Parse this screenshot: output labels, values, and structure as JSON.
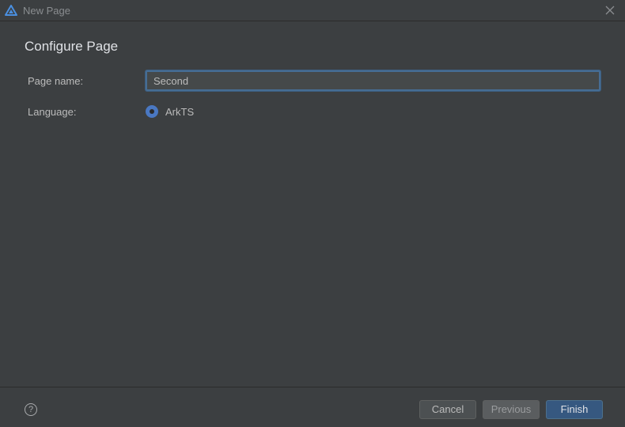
{
  "window": {
    "title": "New Page",
    "app_icon": "deveco-logo-icon",
    "close_icon": "close-icon"
  },
  "heading": "Configure Page",
  "form": {
    "page_name_label": "Page name:",
    "page_name_value": "Second",
    "language_label": "Language:",
    "language_option": "ArkTS",
    "language_selected": true
  },
  "footer": {
    "help_icon": "help-icon",
    "help_glyph": "?",
    "cancel_label": "Cancel",
    "previous_label": "Previous",
    "finish_label": "Finish"
  },
  "colors": {
    "background": "#3c3f41",
    "accent": "#4a78c2",
    "primary_button": "#365880"
  }
}
